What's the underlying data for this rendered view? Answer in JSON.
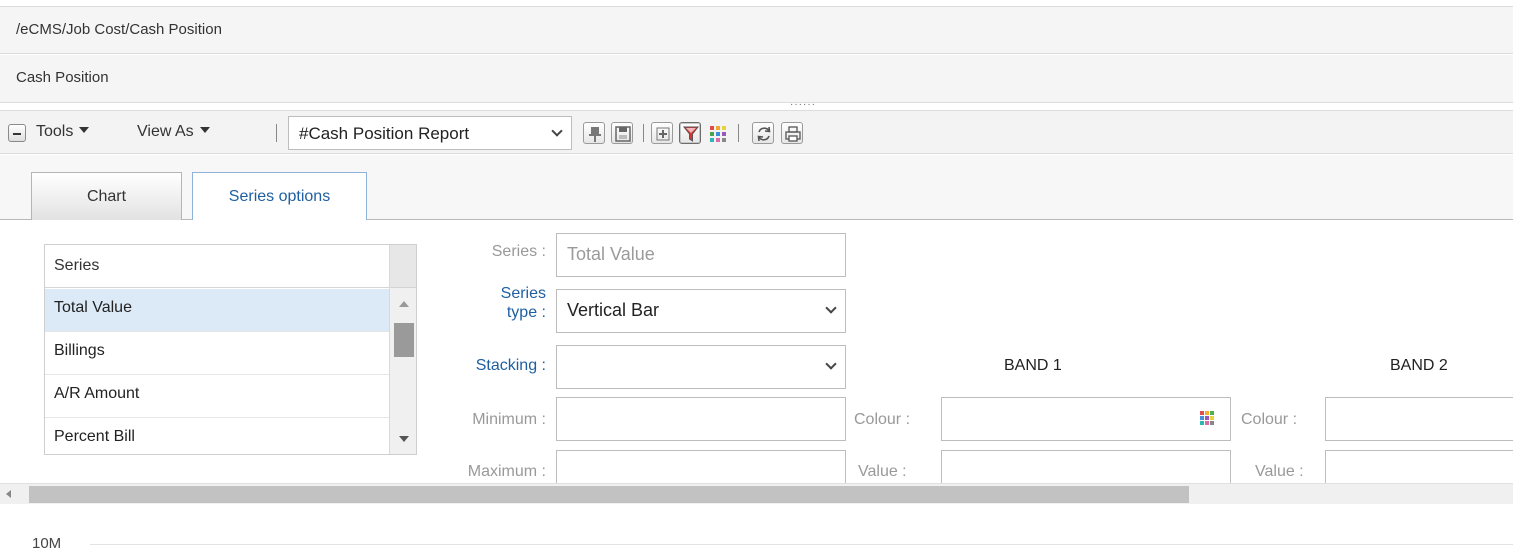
{
  "breadcrumb": "/eCMS/Job Cost/Cash Position",
  "page_title": "Cash Position",
  "toolbar": {
    "tools_label": "Tools",
    "view_as_label": "View As",
    "report_selected": "#Cash Position Report"
  },
  "tabs": [
    {
      "label": "Chart",
      "active": false
    },
    {
      "label": "Series options",
      "active": true
    }
  ],
  "series_list": {
    "header": "Series",
    "items": [
      "Total Value",
      "Billings",
      "A/R Amount",
      "Percent Bill"
    ],
    "selected": "Total Value"
  },
  "form": {
    "series_label": "Series :",
    "series_value": "Total Value",
    "series_type_label_1": "Series",
    "series_type_label_2": "type :",
    "series_type_value": "Vertical Bar",
    "stacking_label": "Stacking :",
    "stacking_value": "",
    "minimum_label": "Minimum :",
    "maximum_label": "Maximum :"
  },
  "bands": [
    {
      "title": "BAND 1",
      "colour_label": "Colour :",
      "value_label": "Value :"
    },
    {
      "title": "BAND 2",
      "colour_label": "Colour :",
      "value_label": "Value :"
    }
  ],
  "chart_axis_tick": "10M",
  "colors": {
    "accent_blue": "#1f5fa0",
    "selected_row": "#dce9f7",
    "toolbar_bg": "#f3f3f3"
  }
}
